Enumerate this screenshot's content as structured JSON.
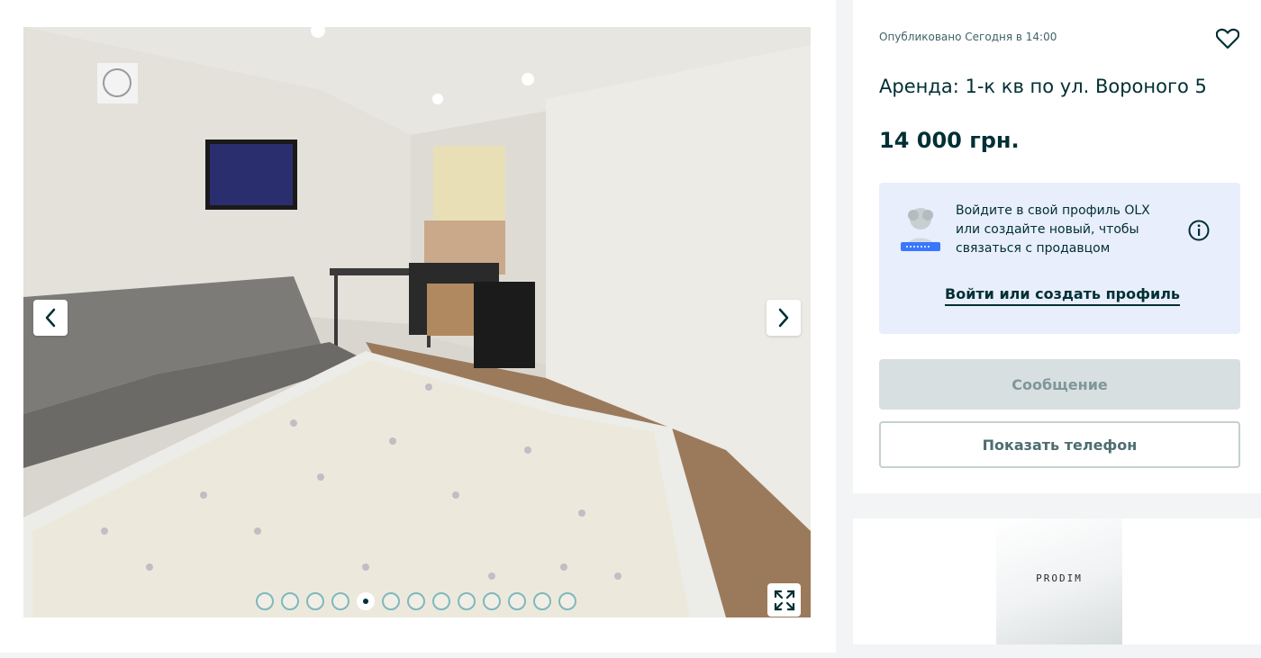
{
  "gallery": {
    "prev_icon": "chevron-left-icon",
    "next_icon": "chevron-right-icon",
    "fullscreen_icon": "expand-icon",
    "dots_count": 13,
    "active_dot_index": 4
  },
  "listing": {
    "published": "Опубликовано Сегодня в 14:00",
    "favorite_icon": "heart-icon",
    "title": "Аренда: 1-к кв по ул. Вороного 5",
    "price": "14 000 грн."
  },
  "login_prompt": {
    "line1": "Войдите в свой профиль OLX",
    "line2": "или создайте новый, чтобы",
    "line3": "связаться с продавцом",
    "link": "Войти или создать профиль",
    "info_icon": "info-icon"
  },
  "actions": {
    "message": "Сообщение",
    "show_phone": "Показать телефон"
  },
  "ad": {
    "logo_text": "PRODIM"
  },
  "colors": {
    "accent": "#002f34",
    "login_bg": "#e8eefc",
    "disabled_btn": "#d8dfe0"
  }
}
